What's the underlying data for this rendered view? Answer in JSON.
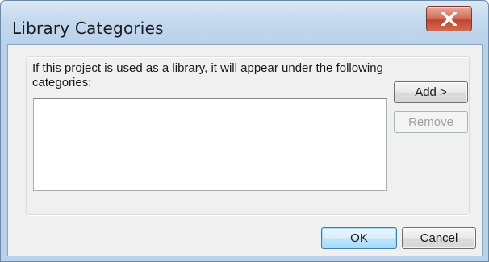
{
  "window": {
    "title": "Library Categories",
    "close_icon": "close-x-icon"
  },
  "group": {
    "label": "If this project is used as a library, it will appear under the following categories:"
  },
  "listbox": {
    "items": []
  },
  "buttons": {
    "add_label": "Add >",
    "remove_label": "Remove",
    "ok_label": "OK",
    "cancel_label": "Cancel"
  },
  "colors": {
    "close_button": "#c2452d",
    "frame": "#b9d1ea",
    "client": "#f0f0f0"
  }
}
